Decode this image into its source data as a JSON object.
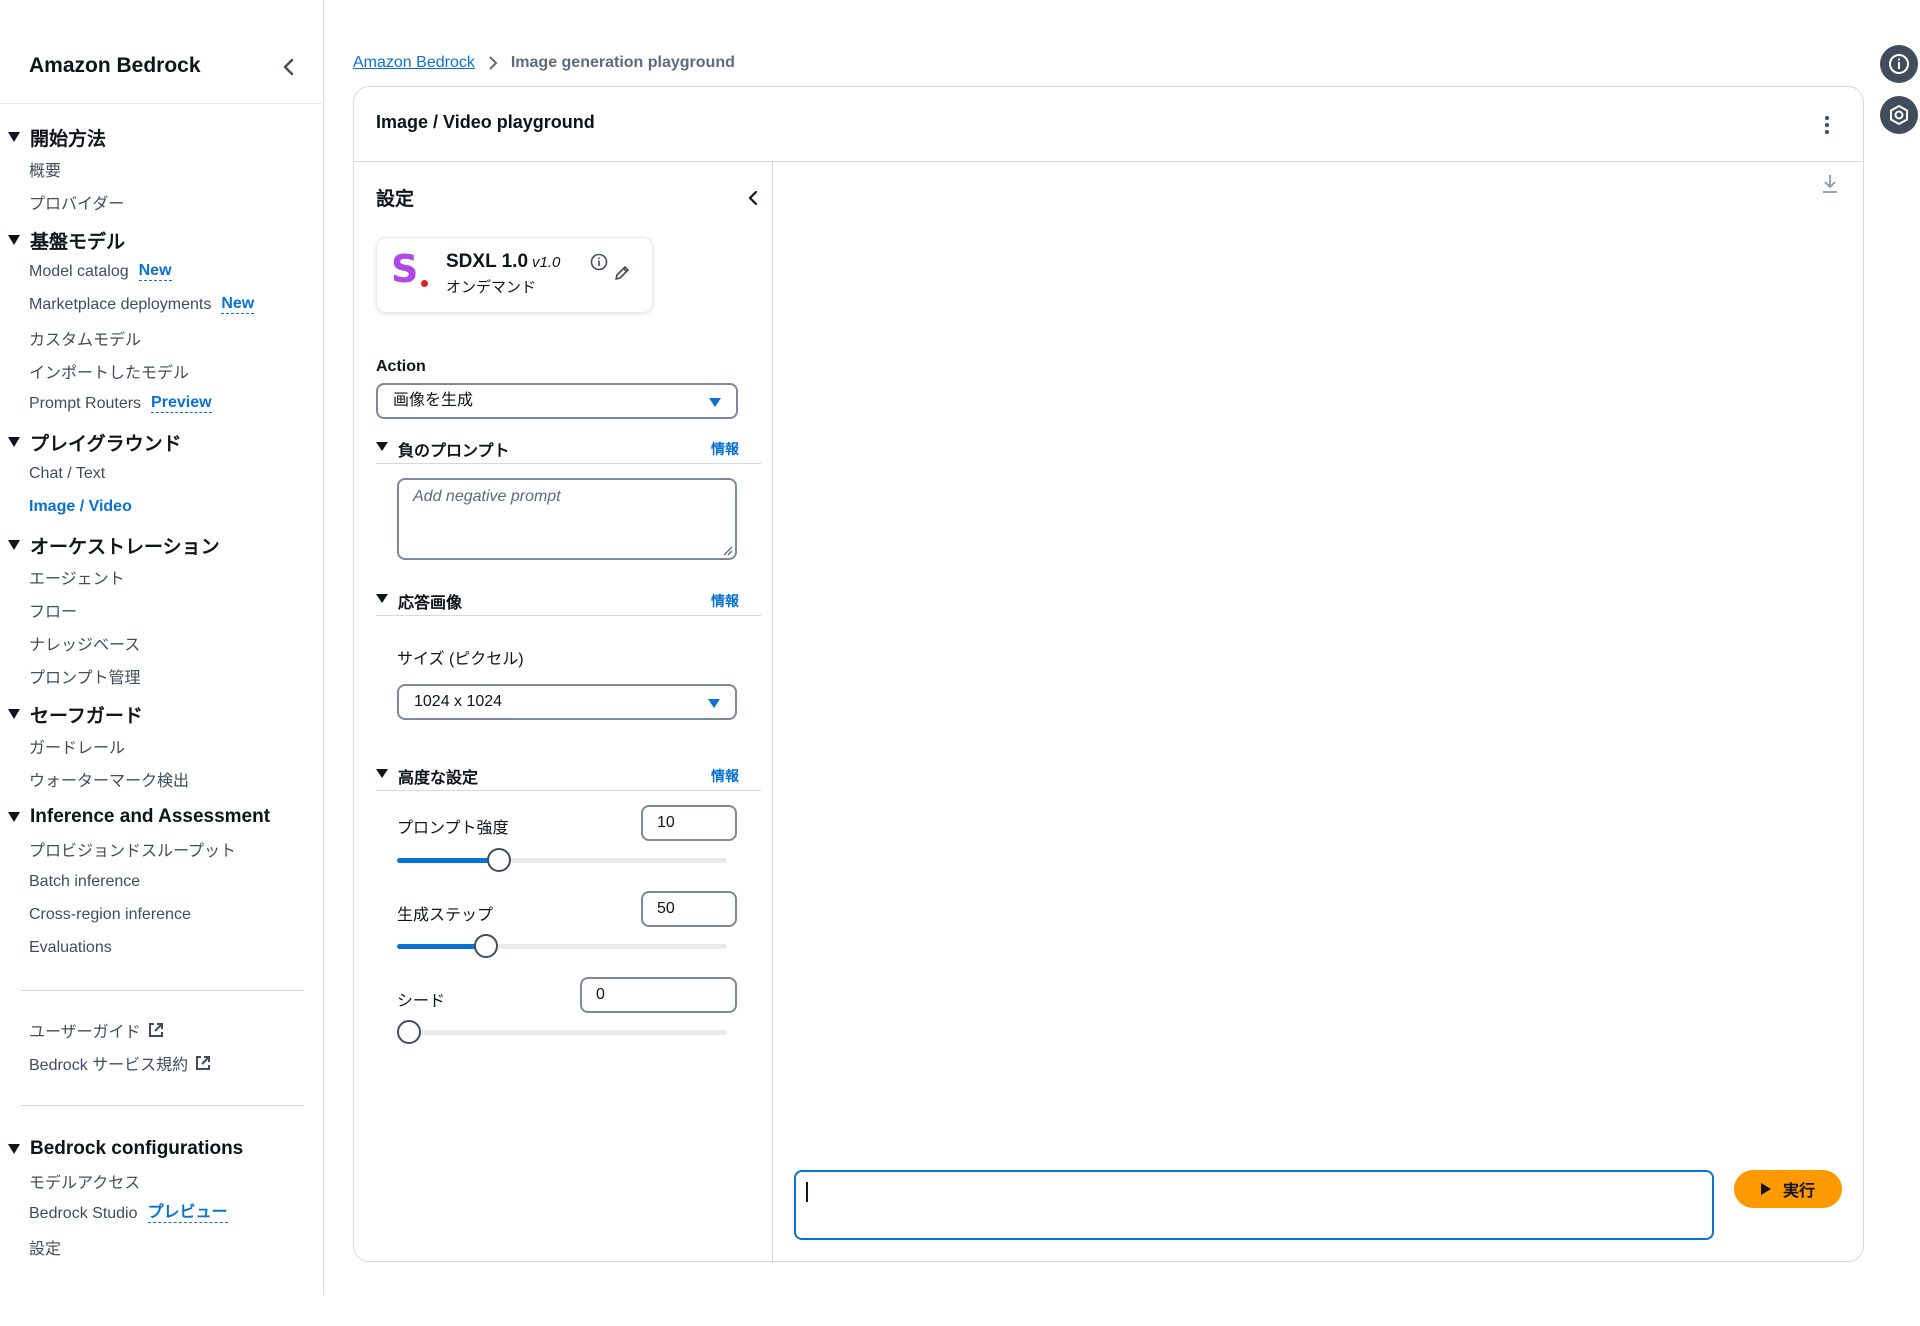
{
  "sidebar": {
    "title": "Amazon Bedrock",
    "sections": [
      {
        "title": "開始方法",
        "items": [
          {
            "label": "概要"
          },
          {
            "label": "プロバイダー"
          }
        ]
      },
      {
        "title": "基盤モデル",
        "items": [
          {
            "label": "Model catalog",
            "badge": "New"
          },
          {
            "label": "Marketplace deployments",
            "badge": "New"
          },
          {
            "label": "カスタムモデル"
          },
          {
            "label": "インポートしたモデル"
          },
          {
            "label": "Prompt Routers",
            "badge": "Preview"
          }
        ]
      },
      {
        "title": "プレイグラウンド",
        "items": [
          {
            "label": "Chat / Text"
          },
          {
            "label": "Image / Video",
            "active": true
          }
        ]
      },
      {
        "title": "オーケストレーション",
        "items": [
          {
            "label": "エージェント"
          },
          {
            "label": "フロー"
          },
          {
            "label": "ナレッジベース"
          },
          {
            "label": "プロンプト管理"
          }
        ]
      },
      {
        "title": "セーフガード",
        "items": [
          {
            "label": "ガードレール"
          },
          {
            "label": "ウォーターマーク検出"
          }
        ]
      },
      {
        "title": "Inference and Assessment",
        "items": [
          {
            "label": "プロビジョンドスループット"
          },
          {
            "label": "Batch inference"
          },
          {
            "label": "Cross-region inference"
          },
          {
            "label": "Evaluations"
          }
        ]
      }
    ],
    "links": [
      {
        "label": "ユーザーガイド"
      },
      {
        "label": "Bedrock サービス規約"
      }
    ],
    "config_section": {
      "title": "Bedrock configurations",
      "items": [
        {
          "label": "モデルアクセス"
        },
        {
          "label": "Bedrock Studio",
          "badge": "プレビュー"
        },
        {
          "label": "設定"
        }
      ]
    }
  },
  "breadcrumb": {
    "root": "Amazon Bedrock",
    "current": "Image generation playground"
  },
  "playground": {
    "title": "Image / Video playground",
    "settings_title": "設定",
    "model": {
      "name": "SDXL 1.0",
      "version": "v1.0",
      "mode": "オンデマンド",
      "logo_letter": "S"
    },
    "action": {
      "label": "Action",
      "value": "画像を生成"
    },
    "negative_prompt": {
      "title": "負のプロンプト",
      "info": "情報",
      "placeholder": "Add negative prompt"
    },
    "response_image": {
      "title": "応答画像",
      "info": "情報",
      "size_label": "サイズ (ピクセル)",
      "size_value": "1024 x 1024"
    },
    "advanced": {
      "title": "高度な設定",
      "info": "情報",
      "prompt_strength": {
        "label": "プロンプト強度",
        "value": "10",
        "fraction": 0.31
      },
      "steps": {
        "label": "生成ステップ",
        "value": "50",
        "fraction": 0.27
      },
      "seed": {
        "label": "シード",
        "value": "0",
        "fraction": 0.0
      }
    },
    "run_button": "実行"
  },
  "colors": {
    "accent": "#0972d3",
    "run": "#ff9900",
    "model_logo": "#b048e8"
  },
  "icons": [
    "chevron-left-icon",
    "chevron-right-icon",
    "info-icon",
    "edit-icon",
    "kebab-icon",
    "download-icon",
    "external-link-icon",
    "play-icon",
    "settings-icon"
  ]
}
